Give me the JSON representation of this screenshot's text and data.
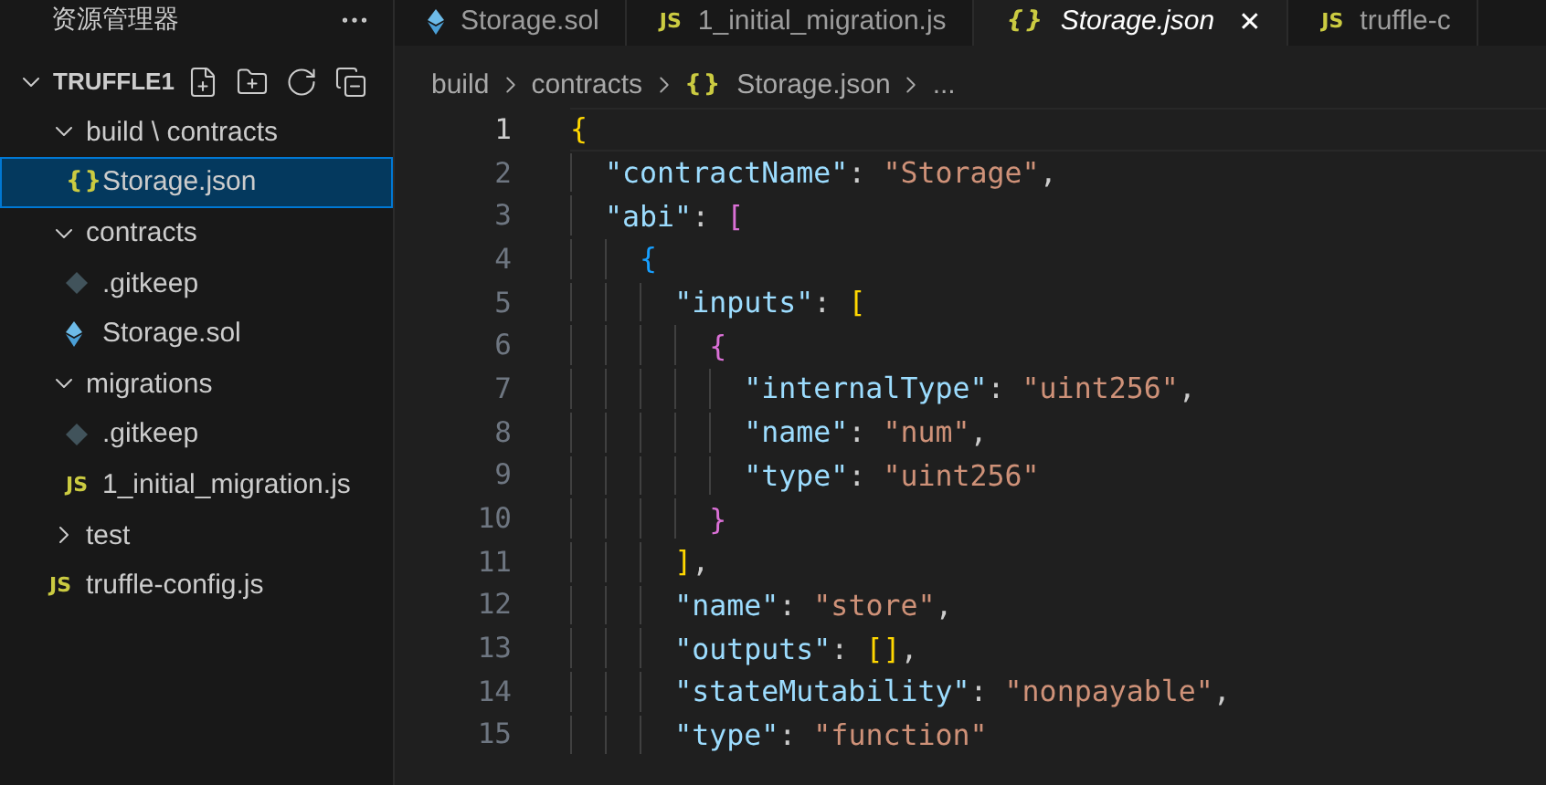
{
  "sidebar": {
    "title": "资源管理器",
    "root": {
      "label": "TRUFFLE1",
      "expanded": true,
      "children": [
        {
          "kind": "folder",
          "label": "build \\ contracts",
          "expanded": true,
          "selected": false,
          "children": [
            {
              "kind": "json",
              "badge": "{}",
              "label": "Storage.json",
              "selected": true
            }
          ]
        },
        {
          "kind": "folder",
          "label": "contracts",
          "expanded": true,
          "selected": false,
          "children": [
            {
              "kind": "gitkeep",
              "label": ".gitkeep",
              "selected": false
            },
            {
              "kind": "sol",
              "label": "Storage.sol",
              "selected": false
            }
          ]
        },
        {
          "kind": "folder",
          "label": "migrations",
          "expanded": true,
          "selected": false,
          "children": [
            {
              "kind": "gitkeep",
              "label": ".gitkeep",
              "selected": false
            },
            {
              "kind": "js",
              "badge": "JS",
              "label": "1_initial_migration.js",
              "selected": false
            }
          ]
        },
        {
          "kind": "folder",
          "label": "test",
          "expanded": false,
          "selected": false
        },
        {
          "kind": "js",
          "badge": "JS",
          "label": "truffle-config.js",
          "selected": false
        }
      ]
    }
  },
  "tabs": [
    {
      "kind": "sol",
      "label": "Storage.sol",
      "selected": false,
      "preview": false
    },
    {
      "kind": "js",
      "badge": "JS",
      "label": "1_initial_migration.js",
      "selected": false,
      "preview": false
    },
    {
      "kind": "json",
      "badge": "{}",
      "label": "Storage.json",
      "selected": true,
      "preview": true,
      "close": "✕"
    },
    {
      "kind": "js",
      "badge": "JS",
      "label": "truffle-c",
      "selected": false,
      "preview": false
    }
  ],
  "breadcrumbs": [
    {
      "label": "build"
    },
    {
      "label": "contracts"
    },
    {
      "badge": "{}",
      "label": "Storage.json"
    },
    {
      "label": "..."
    }
  ],
  "editor": {
    "lines": [
      {
        "number": "1",
        "current": true,
        "tokens": [
          {
            "kind": "bracket",
            "color": "#ffd700",
            "text": "{"
          }
        ],
        "children": [
          {
            "number": "2",
            "current": false,
            "tokens": [
              {
                "kind": "key",
                "text": "\"contractName\""
              },
              {
                "kind": "punct",
                "text": ": "
              },
              {
                "kind": "string",
                "text": "\"Storage\""
              },
              {
                "kind": "punct",
                "text": ","
              }
            ]
          },
          {
            "number": "3",
            "current": false,
            "tokens": [
              {
                "kind": "key",
                "text": "\"abi\""
              },
              {
                "kind": "punct",
                "text": ": "
              },
              {
                "kind": "bracket",
                "color": "#da70d6",
                "text": "["
              }
            ],
            "children": [
              {
                "number": "4",
                "current": false,
                "tokens": [
                  {
                    "kind": "bracket",
                    "color": "#179fff",
                    "text": "{"
                  }
                ],
                "children": [
                  {
                    "number": "5",
                    "current": false,
                    "tokens": [
                      {
                        "kind": "key",
                        "text": "\"inputs\""
                      },
                      {
                        "kind": "punct",
                        "text": ": "
                      },
                      {
                        "kind": "bracket",
                        "color": "#ffd700",
                        "text": "["
                      }
                    ],
                    "children": [
                      {
                        "number": "6",
                        "current": false,
                        "tokens": [
                          {
                            "kind": "bracket",
                            "color": "#da70d6",
                            "text": "{"
                          }
                        ],
                        "children": [
                          {
                            "number": "7",
                            "current": false,
                            "tokens": [
                              {
                                "kind": "key",
                                "text": "\"internalType\""
                              },
                              {
                                "kind": "punct",
                                "text": ": "
                              },
                              {
                                "kind": "string",
                                "text": "\"uint256\""
                              },
                              {
                                "kind": "punct",
                                "text": ","
                              }
                            ]
                          },
                          {
                            "number": "8",
                            "current": false,
                            "tokens": [
                              {
                                "kind": "key",
                                "text": "\"name\""
                              },
                              {
                                "kind": "punct",
                                "text": ": "
                              },
                              {
                                "kind": "string",
                                "text": "\"num\""
                              },
                              {
                                "kind": "punct",
                                "text": ","
                              }
                            ]
                          },
                          {
                            "number": "9",
                            "current": false,
                            "tokens": [
                              {
                                "kind": "key",
                                "text": "\"type\""
                              },
                              {
                                "kind": "punct",
                                "text": ": "
                              },
                              {
                                "kind": "string",
                                "text": "\"uint256\""
                              }
                            ]
                          }
                        ]
                      },
                      {
                        "number": "10",
                        "current": false,
                        "tokens": [
                          {
                            "kind": "bracket",
                            "color": "#da70d6",
                            "text": "}"
                          }
                        ]
                      }
                    ]
                  },
                  {
                    "number": "11",
                    "current": false,
                    "tokens": [
                      {
                        "kind": "bracket",
                        "color": "#ffd700",
                        "text": "]"
                      },
                      {
                        "kind": "punct",
                        "text": ","
                      }
                    ]
                  },
                  {
                    "number": "12",
                    "current": false,
                    "tokens": [
                      {
                        "kind": "key",
                        "text": "\"name\""
                      },
                      {
                        "kind": "punct",
                        "text": ": "
                      },
                      {
                        "kind": "string",
                        "text": "\"store\""
                      },
                      {
                        "kind": "punct",
                        "text": ","
                      }
                    ]
                  },
                  {
                    "number": "13",
                    "current": false,
                    "tokens": [
                      {
                        "kind": "key",
                        "text": "\"outputs\""
                      },
                      {
                        "kind": "punct",
                        "text": ": "
                      },
                      {
                        "kind": "bracket",
                        "color": "#ffd700",
                        "text": "[]"
                      },
                      {
                        "kind": "punct",
                        "text": ","
                      }
                    ]
                  },
                  {
                    "number": "14",
                    "current": false,
                    "tokens": [
                      {
                        "kind": "key",
                        "text": "\"stateMutability\""
                      },
                      {
                        "kind": "punct",
                        "text": ": "
                      },
                      {
                        "kind": "string",
                        "text": "\"nonpayable\""
                      },
                      {
                        "kind": "punct",
                        "text": ","
                      }
                    ]
                  },
                  {
                    "number": "15",
                    "current": false,
                    "tokens": [
                      {
                        "kind": "key",
                        "text": "\"type\""
                      },
                      {
                        "kind": "punct",
                        "text": ": "
                      },
                      {
                        "kind": "string",
                        "text": "\"function\""
                      }
                    ]
                  }
                ]
              }
            ]
          }
        ]
      }
    ]
  }
}
